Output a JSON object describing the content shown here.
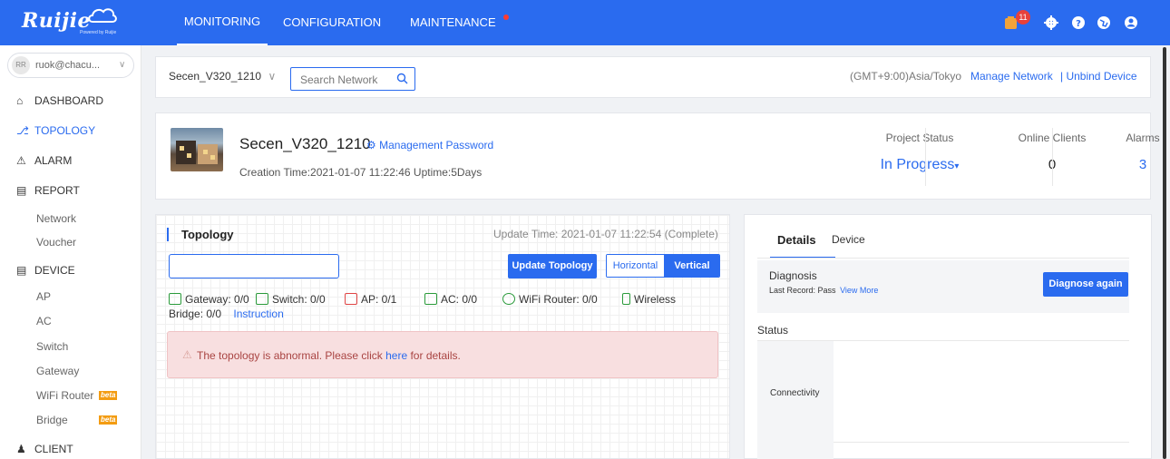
{
  "topbar": {
    "logo_text": "Ruijie",
    "logo_sub": "Powered by Ruijie",
    "nav": {
      "monitoring": "MONITORING",
      "configuration": "CONFIGURATION",
      "maintenance": "MAINTENANCE"
    },
    "notification_count": "11",
    "icons": [
      "bell-icon",
      "gear-icon",
      "help-icon",
      "globe-icon",
      "user-icon"
    ]
  },
  "sidebar": {
    "user": "ruok@chacu...",
    "avatar": "RR",
    "items": {
      "dashboard": "DASHBOARD",
      "topology": "TOPOLOGY",
      "alarm": "ALARM",
      "report": "REPORT",
      "report_network": "Network",
      "report_voucher": "Voucher",
      "device": "DEVICE",
      "device_ap": "AP",
      "device_ac": "AC",
      "device_switch": "Switch",
      "device_gateway": "Gateway",
      "device_wifi_router": "WiFi Router",
      "device_bridge": "Bridge",
      "client": "CLIENT"
    },
    "beta_label": "beta"
  },
  "header": {
    "network_name": "Secen_V320_1210",
    "search_placeholder": "Search Network",
    "timezone": "(GMT+9:00)Asia/Tokyo",
    "manage_network": "Manage Network",
    "unbind_device": "| Unbind Device"
  },
  "project": {
    "name": "Secen_V320_1210",
    "management_password": "Management Password",
    "creation_info": "Creation Time:2021-01-07 11:22:46 Uptime:5Days",
    "project_status_label": "Project Status",
    "project_status_value": "In Progress",
    "online_clients_label": "Online Clients",
    "online_clients_value": "0",
    "alarms_label": "Alarms",
    "alarms_value": "3"
  },
  "topology": {
    "title": "Topology",
    "update_time": "Update Time: 2021-01-07 11:22:54 (Complete)",
    "input_value": "",
    "update_button": "Update Topology",
    "horizontal": "Horizontal",
    "vertical": "Vertical",
    "legend": {
      "gateway": "Gateway: 0/0",
      "switch": "Switch: 0/0",
      "ap": "AP: 0/1",
      "ac": "AC: 0/0",
      "wifi_router": "WiFi Router: 0/0",
      "wireless": "Wireless",
      "bridge": "Bridge: 0/0",
      "instruction": "Instruction"
    },
    "alert_prefix": "The topology is abnormal. Please click ",
    "alert_link": "here",
    "alert_suffix": " for details."
  },
  "details": {
    "tab_details": "Details",
    "tab_device": "Device",
    "diagnosis_title": "Diagnosis",
    "last_record": "Last Record: Pass",
    "view_more": "View More",
    "diagnose_again": "Diagnose again",
    "status_title": "Status",
    "connectivity": "Connectivity"
  },
  "colors": {
    "brand_blue": "#2a6bef",
    "alert_bg": "#f8dfe0",
    "alert_text": "#a94442",
    "gateway_green": "#2a9a3a",
    "ap_red": "#e04545",
    "beta_orange": "#f39c12"
  }
}
